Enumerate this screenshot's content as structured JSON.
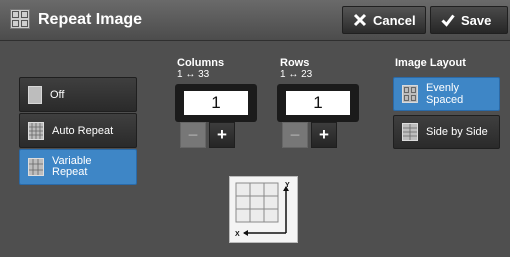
{
  "header": {
    "title": "Repeat Image",
    "cancel_label": "Cancel",
    "save_label": "Save"
  },
  "left_options": {
    "off_label": "Off",
    "auto_label": "Auto Repeat",
    "variable_label_line1": "Variable",
    "variable_label_line2": "Repeat"
  },
  "columns": {
    "label": "Columns",
    "range": "1 ↔ 33",
    "value": "1"
  },
  "rows": {
    "label": "Rows",
    "range": "1 ↔ 23",
    "value": "1"
  },
  "stepper": {
    "minus": "−",
    "plus": "+"
  },
  "layout": {
    "label": "Image Layout",
    "evenly_label": "Evenly Spaced",
    "side_label": "Side by Side"
  },
  "preview": {
    "x_axis": "X",
    "y_axis": "Y"
  },
  "colors": {
    "accent": "#3e86c6"
  }
}
